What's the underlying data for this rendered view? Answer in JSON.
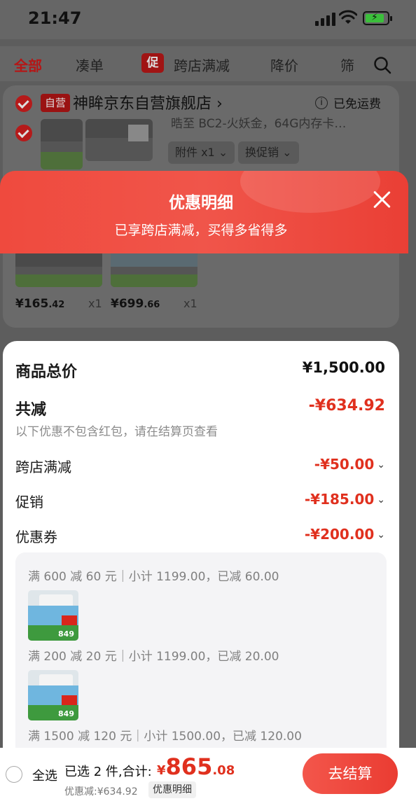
{
  "status_bar": {
    "time": "21:47"
  },
  "tabs": [
    {
      "label": "全部",
      "active": true
    },
    {
      "label": "凑单"
    },
    {
      "label": "跨店满减",
      "badge": "促"
    },
    {
      "label": "降价"
    },
    {
      "label": "筛"
    }
  ],
  "store": {
    "badge": "自营",
    "name": "神眸京东自营旗舰店 ›",
    "shipping": "已免运费",
    "product_desc": "晧至 BC2-火妖金，64G内存卡…",
    "attachments_pill": "附件 x1 ⌄",
    "promo_pill": "换促销 ⌄",
    "items": [
      {
        "price_main": "¥165",
        "price_dec": ".42",
        "qty": "x1"
      },
      {
        "price_main": "¥699",
        "price_dec": ".66",
        "qty": "x1"
      }
    ]
  },
  "banner": {
    "title": "优惠明细",
    "subtitle": "已享跨店满减，买得多省得多"
  },
  "detail": {
    "goods_total_label": "商品总价",
    "goods_total_value": "¥1,500.00",
    "total_discount_label": "共减",
    "total_discount_value": "-¥634.92",
    "note": "以下优惠不包含红包，请在结算页查看",
    "rows": [
      {
        "label": "跨店满减",
        "value": "-¥50.00"
      },
      {
        "label": "促销",
        "value": "-¥185.00"
      },
      {
        "label": "优惠券",
        "value": "-¥200.00"
      }
    ],
    "coupons": [
      {
        "text": "满 600 减 60 元｜小计 1199.00，已减 60.00"
      },
      {
        "text": "满 200 减 20 元｜小计 1199.00，已减 20.00"
      },
      {
        "text": "满 1500 减 120 元｜小计 1500.00，已减 120.00"
      }
    ],
    "thumb_price": "849"
  },
  "bottom_bar": {
    "select_all": "全选",
    "selected_summary": "已选 2 件,合计:",
    "total_yen": "¥",
    "total_int": "865",
    "total_dec": ".08",
    "discount_line": "优惠减:¥634.92",
    "detail_chip": "优惠明细",
    "checkout": "去结算"
  },
  "colors": {
    "accent_red": "#e0301e",
    "banner_red": "#ef4a3e",
    "overlay_gray": "#5d5d5d"
  }
}
